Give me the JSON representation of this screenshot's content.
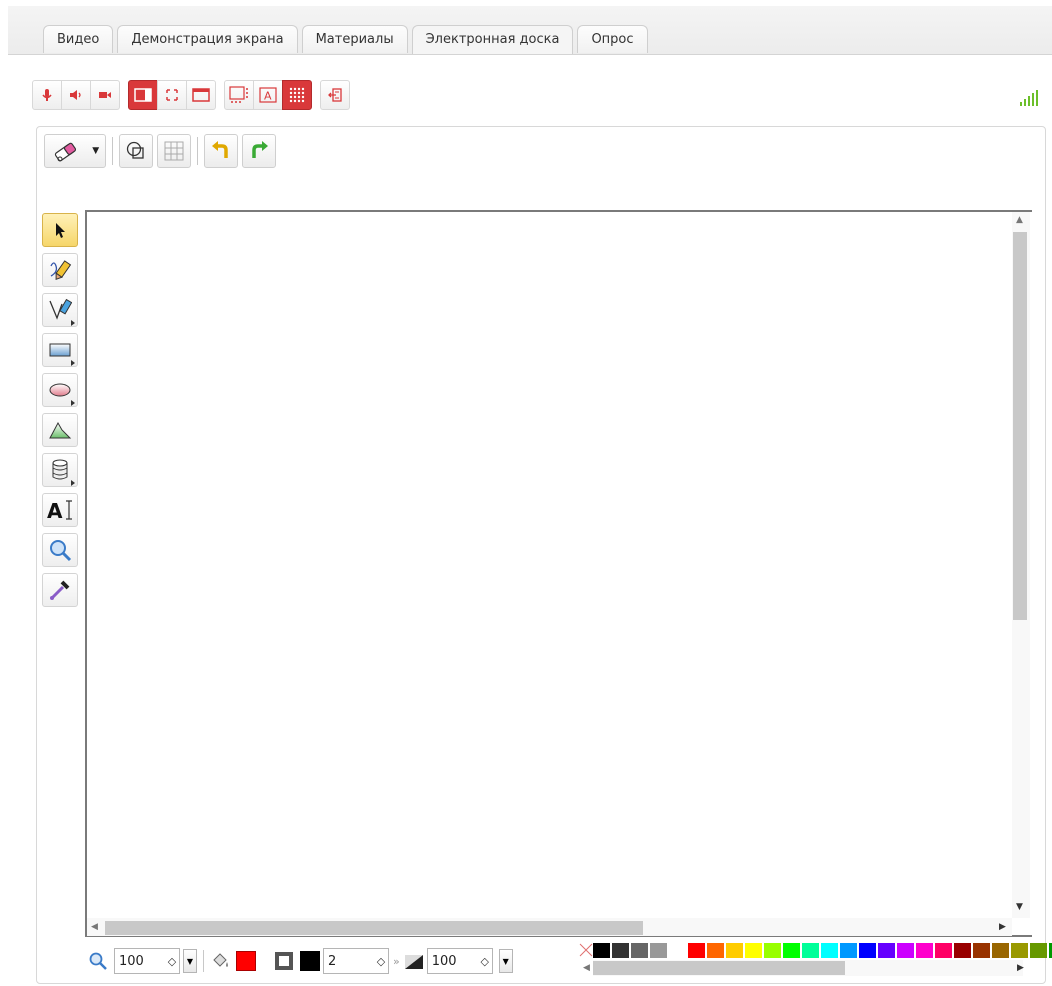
{
  "tabs": [
    {
      "label": "Видео",
      "active": false
    },
    {
      "label": "Демонстрация экрана",
      "active": false
    },
    {
      "label": "Материалы",
      "active": false
    },
    {
      "label": "Электронная доска",
      "active": true
    },
    {
      "label": "Опрос",
      "active": false
    }
  ],
  "media_toolbar": {
    "buttons": [
      "microphone-icon",
      "speaker-icon",
      "camera-icon",
      "layout-sidebar-icon",
      "fullscreen-icon",
      "window-icon",
      "thumbnails-icon",
      "text-layout-icon",
      "grid-layout-icon",
      "exit-icon"
    ],
    "accent_color": "#d9383a"
  },
  "whiteboard": {
    "top_tools": [
      "eraser-icon",
      "shapes-overlay-icon",
      "grid-icon",
      "undo-icon",
      "redo-icon"
    ],
    "left_tools": [
      "pointer-icon",
      "pen-icon",
      "marker-icon",
      "rectangle-icon",
      "ellipse-icon",
      "polygon-icon",
      "cylinder-icon",
      "text-icon",
      "zoom-icon",
      "eyedropper-icon"
    ],
    "selected_tool": "pointer-icon"
  },
  "bottom_bar": {
    "zoom_value": "100",
    "fill_color": "#ff0000",
    "stroke_color": "#000000",
    "stroke_width": "2",
    "opacity_value": "100"
  },
  "palette": [
    "#000000",
    "#333333",
    "#666666",
    "#999999",
    "#ffffff",
    "#ff0000",
    "#ff6600",
    "#ffcc00",
    "#ffff00",
    "#99ff00",
    "#00ff00",
    "#00ff99",
    "#00ffff",
    "#0099ff",
    "#0000ff",
    "#6600ff",
    "#cc00ff",
    "#ff00cc",
    "#ff0066",
    "#990000",
    "#993300",
    "#996600",
    "#999900",
    "#669900",
    "#009900",
    "#009966",
    "#009999"
  ]
}
